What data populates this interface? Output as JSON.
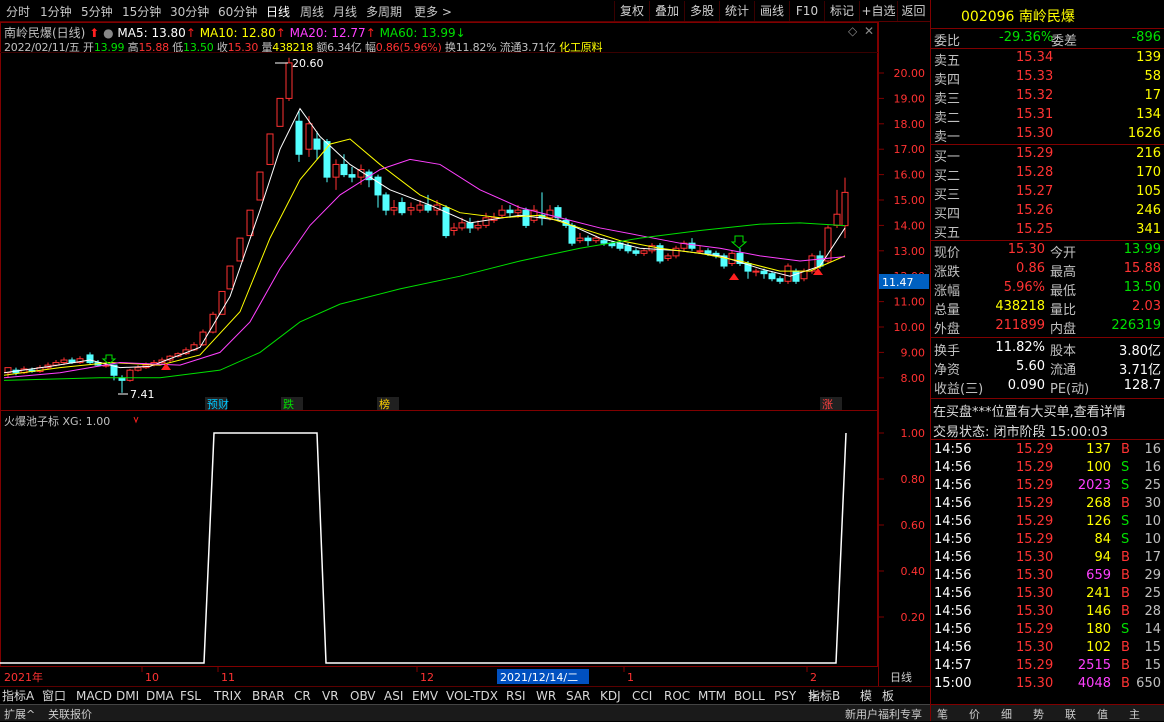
{
  "period_tabs": [
    "分时",
    "1分钟",
    "5分钟",
    "15分钟",
    "30分钟",
    "60分钟",
    "日线",
    "周线",
    "月线",
    "多周期",
    "更多 >"
  ],
  "active_tab": "日线",
  "toolbar_buttons": [
    "复权",
    "叠加",
    "多股",
    "统计",
    "画线",
    "F10",
    "标记",
    "+自选",
    "返回"
  ],
  "stock_title": "南岭民爆(日线)",
  "ma": {
    "ma5": "MA5: 13.80",
    "ma10": "MA10: 12.80",
    "ma20": "MA20: 12.77",
    "ma60": "MA60: 13.99"
  },
  "info": {
    "date": "2022/02/11/五",
    "open_lbl": "开",
    "open": "13.99",
    "high_lbl": "高",
    "high": "15.88",
    "low_lbl": "低",
    "low": "13.50",
    "close_lbl": "收",
    "close": "15.30",
    "vol_lbl": "量",
    "vol": "438218",
    "amt_lbl": "额",
    "amt": "6.34亿",
    "chg_lbl": "幅",
    "chg": "0.86(5.96%)",
    "turnover": "换11.82%",
    "float": "流通3.71亿",
    "sector": "化工原料"
  },
  "colors": {
    "ma5": "#ffffff",
    "ma10": "#ffff00",
    "ma20": "#ff40ff",
    "ma60": "#00e000",
    "up": "#ff3232",
    "down": "#54ffff",
    "border": "#800000"
  },
  "price_axis": [
    "20.00",
    "19.00",
    "18.00",
    "17.00",
    "16.00",
    "15.00",
    "14.00",
    "13.00",
    "12.00",
    "11.00",
    "10.00",
    "9.00",
    "8.00"
  ],
  "price_tag": "11.47",
  "annotations": {
    "high": "20.60",
    "low": "7.41"
  },
  "event_tags": [
    "预财",
    "跌",
    "榜",
    "涨"
  ],
  "indicator": {
    "title": "火爆池子标 XG: 1.00",
    "axis": [
      "1.00",
      "0.80",
      "0.60",
      "0.40",
      "0.20"
    ]
  },
  "date_axis": {
    "year": "2021年",
    "m10": "10",
    "m11": "11",
    "m12": "12",
    "cursor": "2021/12/14/二",
    "m1": "1",
    "m2": "2",
    "period": "日线"
  },
  "bottom_tabs": [
    "指标A",
    "窗口",
    "MACD",
    "DMI",
    "DMA",
    "FSL",
    "TRIX",
    "BRAR",
    "CR",
    "VR",
    "OBV",
    "ASI",
    "EMV",
    "VOL-TDX",
    "RSI",
    "WR",
    "SAR",
    "KDJ",
    "CCI",
    "ROC",
    "MTM",
    "BOLL",
    "PSY",
    ">"
  ],
  "bottom_right": [
    "指标B",
    "模",
    "板"
  ],
  "status": {
    "left1": "扩展^",
    "left2": "关联报价",
    "right": "新用户福利专享"
  },
  "quote": {
    "code": "002096",
    "name": "南岭民爆",
    "weibi_lbl": "委比",
    "weibi": "-29.36%",
    "weicha_lbl": "委差",
    "weicha": "-896",
    "sell": [
      {
        "l": "卖五",
        "p": "15.34",
        "v": "139"
      },
      {
        "l": "卖四",
        "p": "15.33",
        "v": "58"
      },
      {
        "l": "卖三",
        "p": "15.32",
        "v": "17"
      },
      {
        "l": "卖二",
        "p": "15.31",
        "v": "134"
      },
      {
        "l": "卖一",
        "p": "15.30",
        "v": "1626"
      }
    ],
    "buy": [
      {
        "l": "买一",
        "p": "15.29",
        "v": "216"
      },
      {
        "l": "买二",
        "p": "15.28",
        "v": "170"
      },
      {
        "l": "买三",
        "p": "15.27",
        "v": "105"
      },
      {
        "l": "买四",
        "p": "15.26",
        "v": "246"
      },
      {
        "l": "买五",
        "p": "15.25",
        "v": "341"
      }
    ],
    "stats": [
      {
        "l1": "现价",
        "v1": "15.30",
        "c1": "red",
        "l2": "今开",
        "v2": "13.99",
        "c2": "green"
      },
      {
        "l1": "涨跌",
        "v1": "0.86",
        "c1": "red",
        "l2": "最高",
        "v2": "15.88",
        "c2": "red"
      },
      {
        "l1": "涨幅",
        "v1": "5.96%",
        "c1": "red",
        "l2": "最低",
        "v2": "13.50",
        "c2": "green"
      },
      {
        "l1": "总量",
        "v1": "438218",
        "c1": "yellow",
        "l2": "量比",
        "v2": "2.03",
        "c2": "red"
      },
      {
        "l1": "外盘",
        "v1": "211899",
        "c1": "red",
        "l2": "内盘",
        "v2": "226319",
        "c2": "green"
      }
    ],
    "stats2": [
      {
        "l1": "换手",
        "v1": "11.82%",
        "l2": "股本",
        "v2": "3.80亿"
      },
      {
        "l1": "净资",
        "v1": "5.60",
        "l2": "流通",
        "v2": "3.71亿"
      },
      {
        "l1": "收益(三)",
        "v1": "0.090",
        "l2": "PE(动)",
        "v2": "128.7"
      }
    ],
    "notice": "在买盘***位置有大买单,查看详情",
    "state_lbl": "交易状态: 闭市阶段",
    "state_time": "15:00:03",
    "ticks": [
      {
        "t": "14:56",
        "p": "15.29",
        "v": "137",
        "s": "B",
        "n": "16"
      },
      {
        "t": "14:56",
        "p": "15.29",
        "v": "100",
        "s": "S",
        "n": "16"
      },
      {
        "t": "14:56",
        "p": "15.29",
        "v": "2023",
        "s": "S",
        "n": "25"
      },
      {
        "t": "14:56",
        "p": "15.29",
        "v": "268",
        "s": "B",
        "n": "30"
      },
      {
        "t": "14:56",
        "p": "15.29",
        "v": "126",
        "s": "S",
        "n": "10"
      },
      {
        "t": "14:56",
        "p": "15.29",
        "v": "84",
        "s": "S",
        "n": "10"
      },
      {
        "t": "14:56",
        "p": "15.30",
        "v": "94",
        "s": "B",
        "n": "17"
      },
      {
        "t": "14:56",
        "p": "15.30",
        "v": "659",
        "s": "B",
        "n": "29"
      },
      {
        "t": "14:56",
        "p": "15.30",
        "v": "241",
        "s": "B",
        "n": "25"
      },
      {
        "t": "14:56",
        "p": "15.30",
        "v": "146",
        "s": "B",
        "n": "28"
      },
      {
        "t": "14:56",
        "p": "15.29",
        "v": "180",
        "s": "S",
        "n": "14"
      },
      {
        "t": "14:56",
        "p": "15.30",
        "v": "102",
        "s": "B",
        "n": "15"
      },
      {
        "t": "14:57",
        "p": "15.29",
        "v": "2515",
        "s": "B",
        "n": "15"
      },
      {
        "t": "15:00",
        "p": "15.30",
        "v": "4048",
        "s": "B",
        "n": "650"
      }
    ],
    "footer_tabs": [
      "笔",
      "价",
      "细",
      "势",
      "联",
      "值",
      "主"
    ]
  }
}
